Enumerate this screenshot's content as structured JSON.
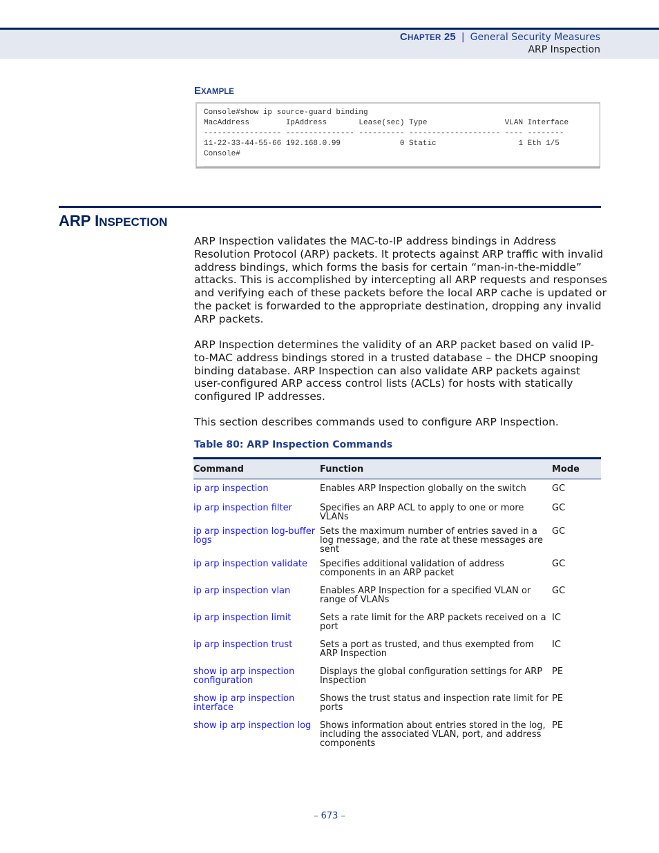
{
  "header": {
    "chapter_prefix": "C",
    "chapter_rest": "HAPTER",
    "chapter_number": "25",
    "separator": "|",
    "chapter_title": "General Security Measures",
    "section_title": "ARP Inspection"
  },
  "example": {
    "heading_first": "E",
    "heading_rest": "XAMPLE",
    "code_lines": [
      "Console#show ip source-guard binding",
      "MacAddress        IpAddress       Lease(sec) Type                 VLAN Interface",
      "----------------- --------------- ---------- -------------------- ---- --------",
      "11-22-33-44-55-66 192.168.0.99             0 Static                  1 Eth 1/5",
      "Console#"
    ]
  },
  "section": {
    "title_first": "ARP I",
    "title_rest": "NSPECTION",
    "paragraphs": [
      "ARP Inspection validates the MAC-to-IP address bindings in Address Resolution Protocol (ARP) packets. It protects against ARP traffic with invalid address bindings, which forms the basis for certain “man-in-the-middle” attacks. This is accomplished by intercepting all ARP requests and responses and verifying each of these packets before the local ARP cache is updated or the packet is forwarded to the appropriate destination, dropping any invalid ARP packets.",
      "ARP Inspection determines the validity of an ARP packet based on valid IP-to-MAC address bindings stored in a trusted database – the DHCP snooping binding database. ARP Inspection can also validate ARP packets against user-configured ARP access control lists (ACLs) for hosts with statically configured IP addresses.",
      "This section describes commands used to configure ARP Inspection."
    ]
  },
  "table": {
    "caption": "Table 80: ARP Inspection Commands",
    "columns": [
      "Command",
      "Function",
      "Mode"
    ],
    "rows": [
      {
        "command": "ip arp inspection",
        "function": "Enables ARP Inspection globally on the switch",
        "mode": "GC"
      },
      {
        "command": "ip arp inspection filter",
        "function": "Specifies an ARP ACL to apply to one or more VLANs",
        "mode": "GC"
      },
      {
        "command": "ip arp inspection log-buffer logs",
        "function": "Sets the maximum number of entries saved in a log message, and the rate at these messages are sent",
        "mode": "GC"
      },
      {
        "command": "ip arp inspection validate",
        "function": "Specifies additional validation of address components in an ARP packet",
        "mode": "GC"
      },
      {
        "command": "ip arp inspection vlan",
        "function": "Enables ARP Inspection for a specified VLAN or range of VLANs",
        "mode": "GC"
      },
      {
        "command": "ip arp inspection limit",
        "function": "Sets a rate limit for the ARP packets received on a port",
        "mode": "IC"
      },
      {
        "command": "ip arp inspection trust",
        "function": "Sets a port as trusted, and thus exempted from ARP Inspection",
        "mode": "IC"
      },
      {
        "command": "show ip arp inspection configuration",
        "function": "Displays the global configuration settings for ARP Inspection",
        "mode": "PE"
      },
      {
        "command": "show ip arp inspection interface",
        "function": "Shows the trust status and inspection rate limit for ports",
        "mode": "PE"
      },
      {
        "command": "show ip arp inspection log",
        "function": "Shows information about entries stored in the log, including the associated VLAN, port, and address components",
        "mode": "PE"
      }
    ]
  },
  "footer": {
    "page_number": "–  673  –"
  },
  "colors": {
    "brand_navy": "#002060",
    "heading_blue": "#1f3f8f",
    "link_blue": "#1a1aff",
    "header_band": "#e4e8f1"
  }
}
